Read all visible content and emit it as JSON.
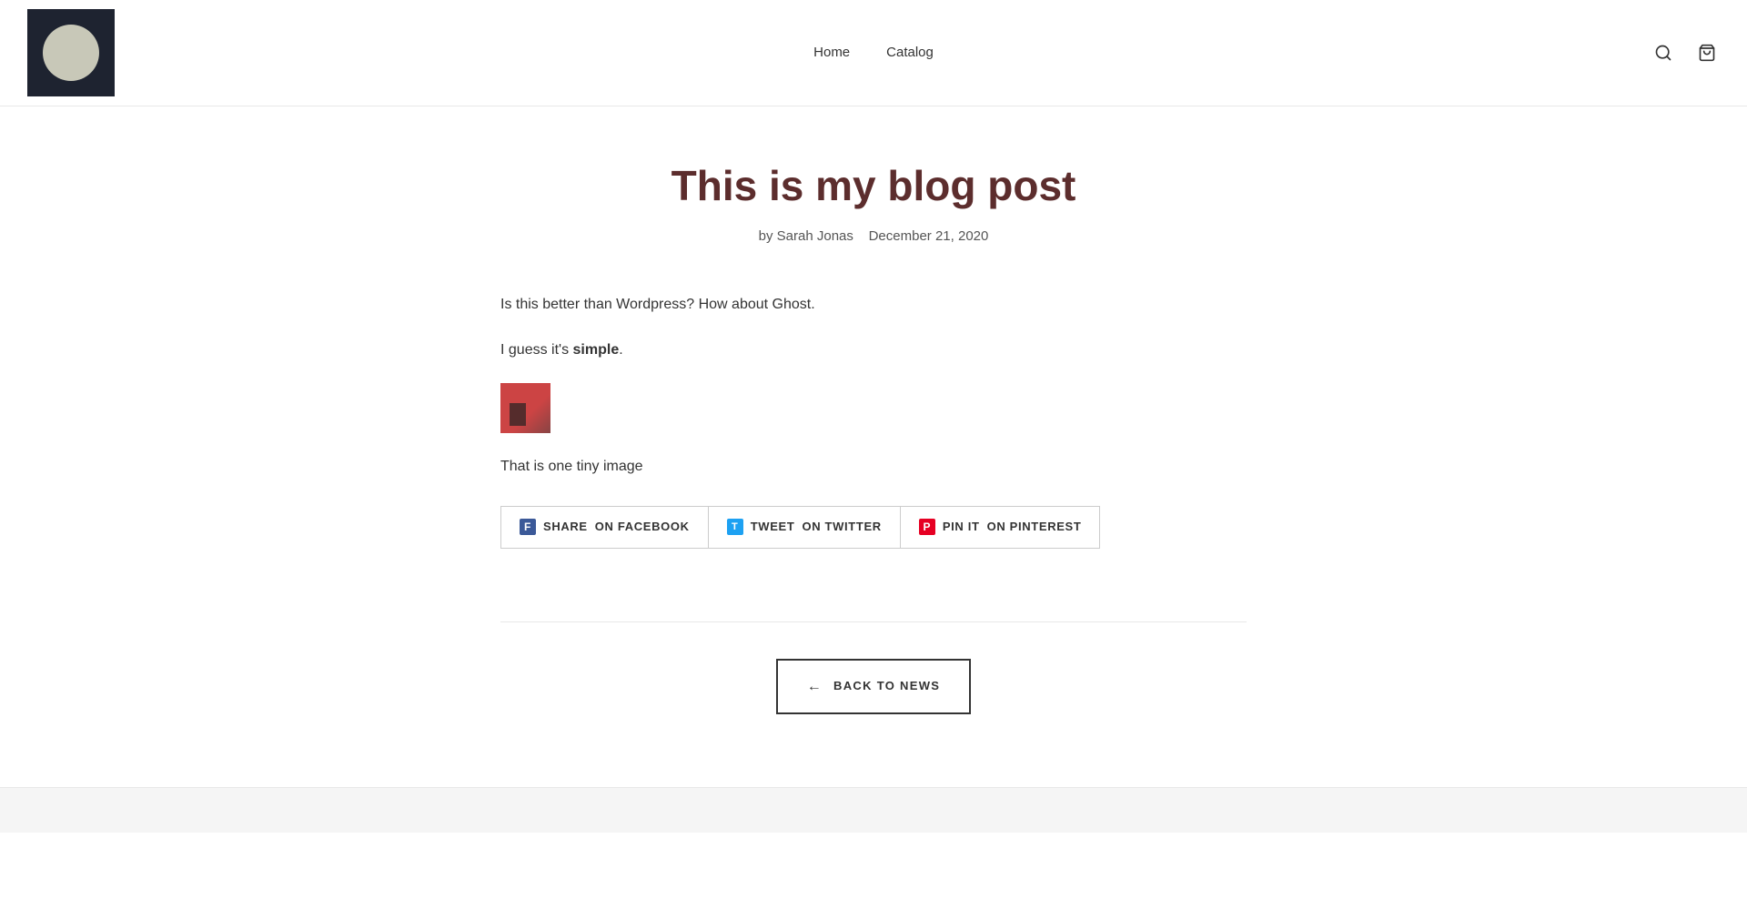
{
  "header": {
    "nav": {
      "home_label": "Home",
      "catalog_label": "Catalog"
    },
    "search_title": "Search",
    "cart_title": "Cart"
  },
  "article": {
    "title": "This is my blog post",
    "meta": {
      "author_prefix": "by",
      "author": "Sarah Jonas",
      "date": "December 21, 2020"
    },
    "paragraphs": {
      "p1": "Is this better than Wordpress? How about Ghost.",
      "p2_prefix": "I guess it's ",
      "p2_bold": "simple",
      "p2_suffix": ".",
      "p3": "That is one tiny image"
    },
    "share": {
      "facebook_label": "SHARE",
      "twitter_label": "TWEET",
      "pinterest_label": "PIN IT"
    },
    "back_button": "BACK TO NEWS"
  }
}
